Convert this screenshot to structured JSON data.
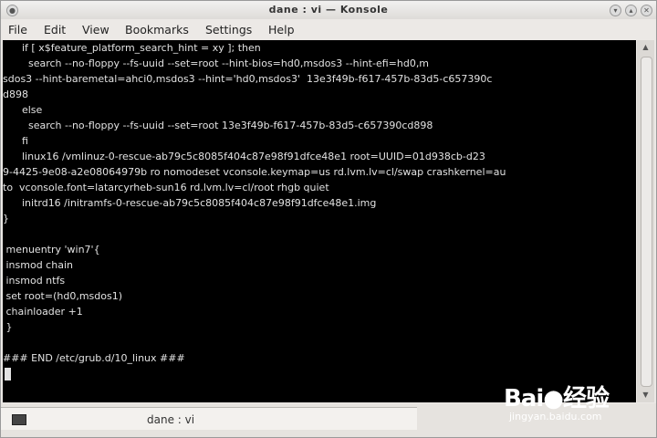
{
  "window": {
    "title": "dane : vi — Konsole"
  },
  "menubar": {
    "items": [
      "File",
      "Edit",
      "View",
      "Bookmarks",
      "Settings",
      "Help"
    ]
  },
  "terminal": {
    "lines": [
      "      if [ x$feature_platform_search_hint = xy ]; then",
      "        search --no-floppy --fs-uuid --set=root --hint-bios=hd0,msdos3 --hint-efi=hd0,m",
      "sdos3 --hint-baremetal=ahci0,msdos3 --hint='hd0,msdos3'  13e3f49b-f617-457b-83d5-c657390c",
      "d898",
      "      else",
      "        search --no-floppy --fs-uuid --set=root 13e3f49b-f617-457b-83d5-c657390cd898",
      "      fi",
      "      linux16 /vmlinuz-0-rescue-ab79c5c8085f404c87e98f91dfce48e1 root=UUID=01d938cb-d23",
      "9-4425-9e08-a2e08064979b ro nomodeset vconsole.keymap=us rd.lvm.lv=cl/swap crashkernel=au",
      "to  vconsole.font=latarcyrheb-sun16 rd.lvm.lv=cl/root rhgb quiet",
      "      initrd16 /initramfs-0-rescue-ab79c5c8085f404c87e98f91dfce48e1.img",
      "}",
      "",
      " menuentry 'win7'{",
      " insmod chain",
      " insmod ntfs",
      " set root=(hd0,msdos1)",
      " chainloader +1",
      " }",
      "",
      "### END /etc/grub.d/10_linux ###"
    ]
  },
  "tabbar": {
    "tab_label": "dane : vi"
  },
  "watermark": {
    "logo": "Bai●经验",
    "url": "jingyan.baidu.com"
  }
}
